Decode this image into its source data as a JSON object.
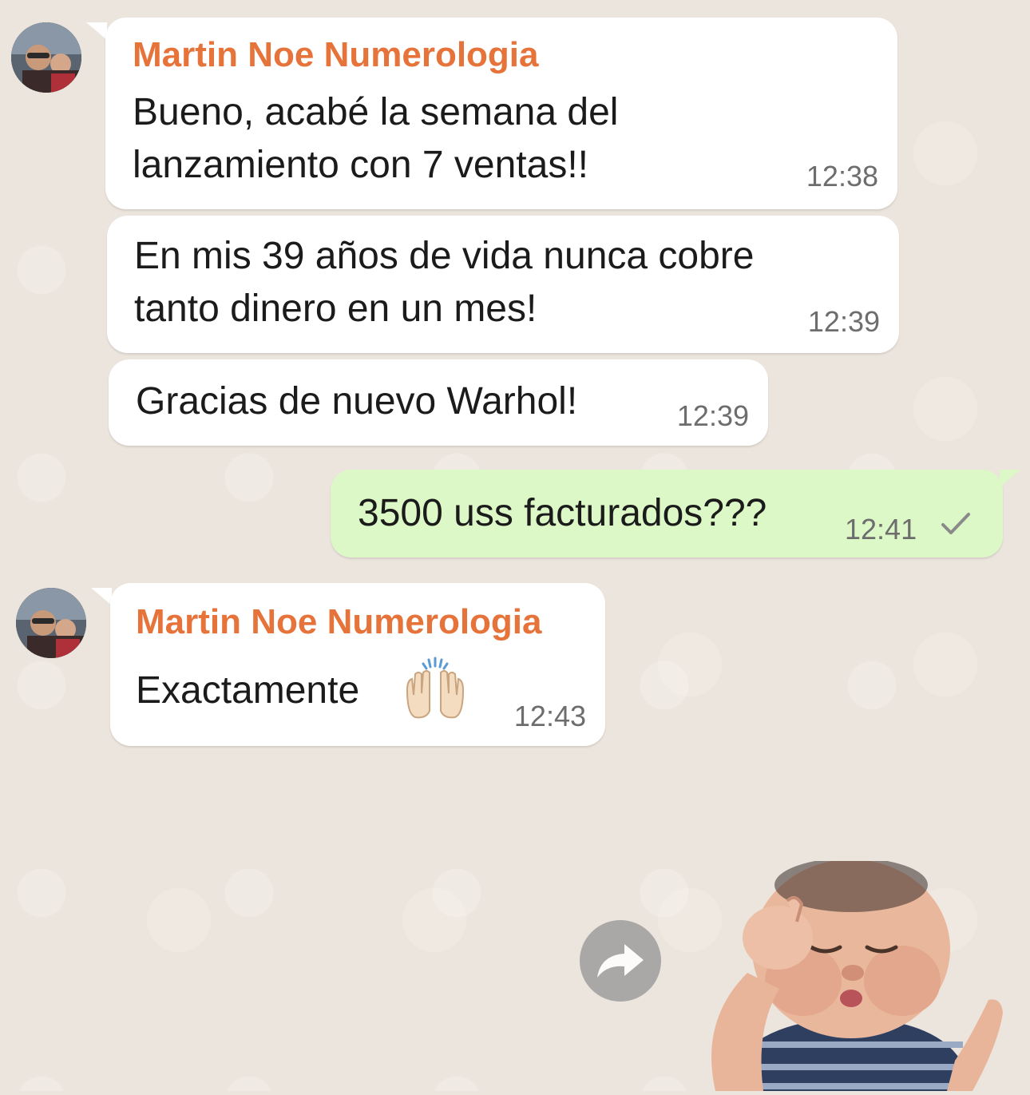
{
  "contact": {
    "name": "Martin Noe Numerologia"
  },
  "messages": [
    {
      "sender": "Martin Noe Numerologia",
      "lines": [
        "Bueno, acabé la semana del",
        "lanzamiento con 7 ventas!!"
      ],
      "time": "12:38"
    },
    {
      "lines": [
        "En mis 39 años de vida nunca cobre",
        "tanto dinero en un mes!"
      ],
      "time": "12:39"
    },
    {
      "lines": [
        "Gracias de nuevo Warhol!"
      ],
      "time": "12:39"
    },
    {
      "outgoing": true,
      "lines": [
        "3500 uss facturados???"
      ],
      "time": "12:41",
      "status": "sent-check"
    },
    {
      "sender": "Martin Noe Numerologia",
      "lines": [
        "Exactamente"
      ],
      "emoji": "raising-hands-icon",
      "time": "12:43"
    }
  ],
  "colors": {
    "background": "#ece5dd",
    "incoming_bubble": "#ffffff",
    "outgoing_bubble": "#dcf8c6",
    "sender_name": "#e6733a",
    "timestamp": "#6d6d6d"
  },
  "sticker": {
    "icon": "baby-sticker"
  },
  "forward": {
    "icon": "forward-arrow-icon"
  }
}
